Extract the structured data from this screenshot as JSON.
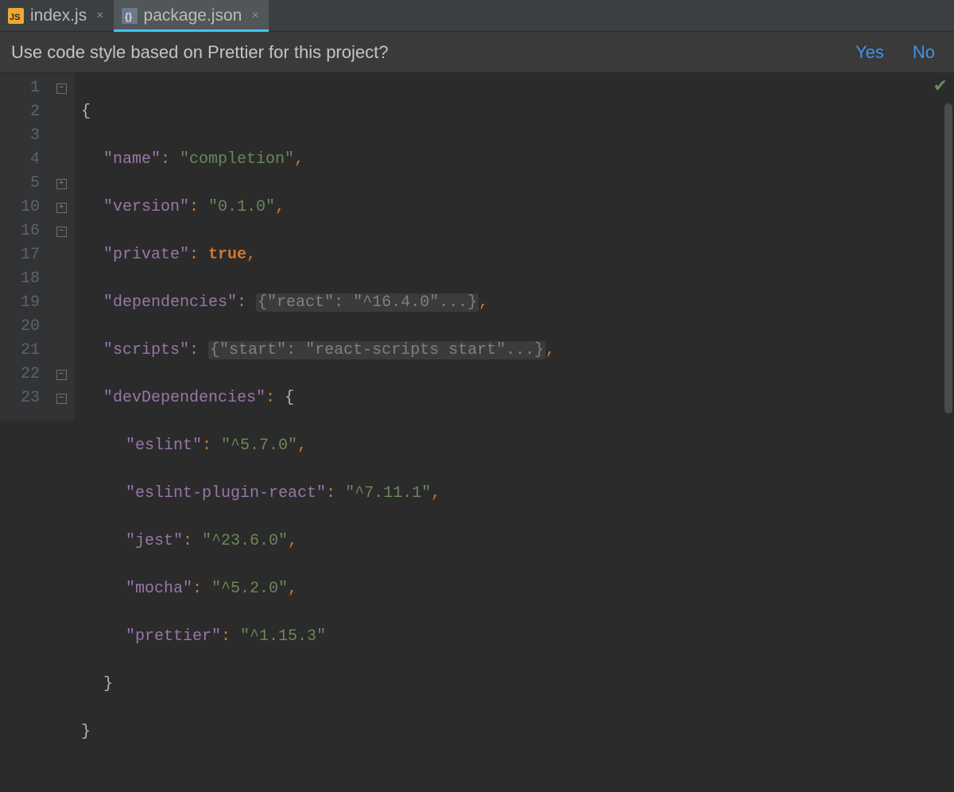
{
  "tabs": [
    {
      "label": "index.js",
      "active": false
    },
    {
      "label": "package.json",
      "active": true
    }
  ],
  "notification": {
    "message": "Use code style based on Prettier for this project?",
    "yes": "Yes",
    "no": "No"
  },
  "gutter_lines": [
    "1",
    "2",
    "3",
    "4",
    "5",
    "10",
    "16",
    "17",
    "18",
    "19",
    "20",
    "21",
    "22",
    "23"
  ],
  "fold_icons": [
    "minus",
    "",
    "",
    "",
    "plus",
    "plus",
    "minus",
    "",
    "",
    "",
    "",
    "",
    "end",
    "end"
  ],
  "code": {
    "open_brace": "{",
    "name_key": "\"name\"",
    "name_val": "\"completion\"",
    "version_key": "\"version\"",
    "version_val": "\"0.1.0\"",
    "private_key": "\"private\"",
    "private_val": "true",
    "deps_key": "\"dependencies\"",
    "deps_fold": "{\"react\": \"^16.4.0\"...}",
    "scripts_key": "\"scripts\"",
    "scripts_fold": "{\"start\": \"react-scripts start\"...}",
    "devdeps_key": "\"devDependencies\"",
    "dev": {
      "eslint_key": "\"eslint\"",
      "eslint_val": "\"^5.7.0\"",
      "eslint_plugin_key": "\"eslint-plugin-react\"",
      "eslint_plugin_val": "\"^7.11.1\"",
      "jest_key": "\"jest\"",
      "jest_val": "\"^23.6.0\"",
      "mocha_key": "\"mocha\"",
      "mocha_val": "\"^5.2.0\"",
      "prettier_key": "\"prettier\"",
      "prettier_val": "\"^1.15.3\""
    },
    "close_inner": "}",
    "close_outer": "}"
  }
}
